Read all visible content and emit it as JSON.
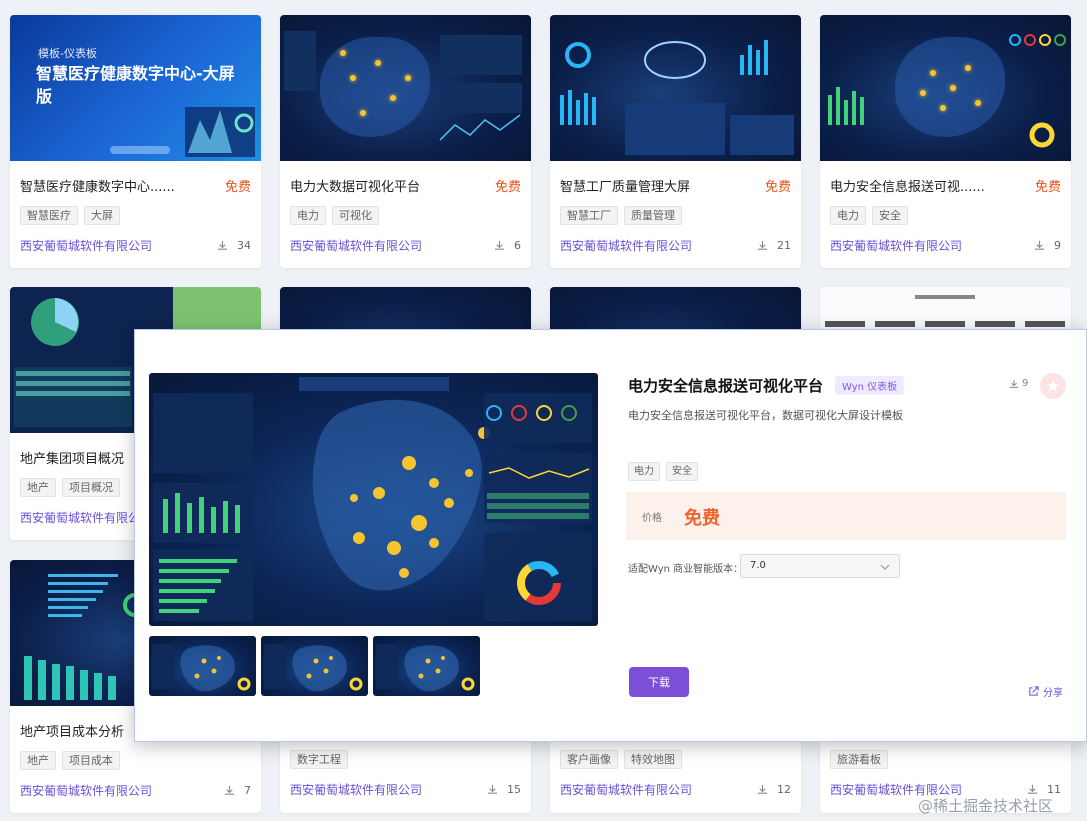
{
  "cards": [
    {
      "title": "智慧医疗健康数字中心......",
      "price": "免费",
      "tags": [
        "智慧医疗",
        "大屏"
      ],
      "company": "西安葡萄城软件有限公司",
      "downloads": "34",
      "thumb_label": "模板-仪表板",
      "thumb_title": "智慧医疗健康数字中心-大屏版"
    },
    {
      "title": "电力大数据可视化平台",
      "price": "免费",
      "tags": [
        "电力",
        "可视化"
      ],
      "company": "西安葡萄城软件有限公司",
      "downloads": "6"
    },
    {
      "title": "智慧工厂质量管理大屏",
      "price": "免费",
      "tags": [
        "智慧工厂",
        "质量管理"
      ],
      "company": "西安葡萄城软件有限公司",
      "downloads": "21"
    },
    {
      "title": "电力安全信息报送可视......",
      "price": "免费",
      "tags": [
        "电力",
        "安全"
      ],
      "company": "西安葡萄城软件有限公司",
      "downloads": "9"
    },
    {
      "title": "地产集团项目概况",
      "tags": [
        "地产",
        "项目概况"
      ],
      "company": "西安葡萄城软件有限公司"
    },
    {
      "title": "地产项目成本分析",
      "tags": [
        "地产",
        "项目成本"
      ],
      "company": "西安葡萄城软件有限公司",
      "downloads": "7"
    },
    {
      "tags": [
        "数字工程"
      ],
      "company": "西安葡萄城软件有限公司",
      "downloads": "15"
    },
    {
      "tags": [
        "客户画像",
        "特效地图"
      ],
      "company": "西安葡萄城软件有限公司",
      "downloads": "12"
    },
    {
      "tags": [
        "旅游看板"
      ],
      "company": "西安葡萄城软件有限公司",
      "downloads": "11"
    }
  ],
  "modal": {
    "title": "电力安全信息报送可视化平台",
    "badge": "Wyn 仪表板",
    "downloads": "9",
    "description": "电力安全信息报送可视化平台，数据可视化大屏设计模板",
    "tags": [
      "电力",
      "安全"
    ],
    "price_label": "价格",
    "price_value": "免费",
    "version_label": "适配Wyn 商业智能版本：",
    "version_value": "7.0",
    "download_button": "下载",
    "share_label": "分享"
  },
  "watermark": "@稀土掘金技术社区",
  "colors": {
    "accent": "#7b4fd8",
    "price": "#e8531b",
    "company": "#6a4fd8"
  }
}
